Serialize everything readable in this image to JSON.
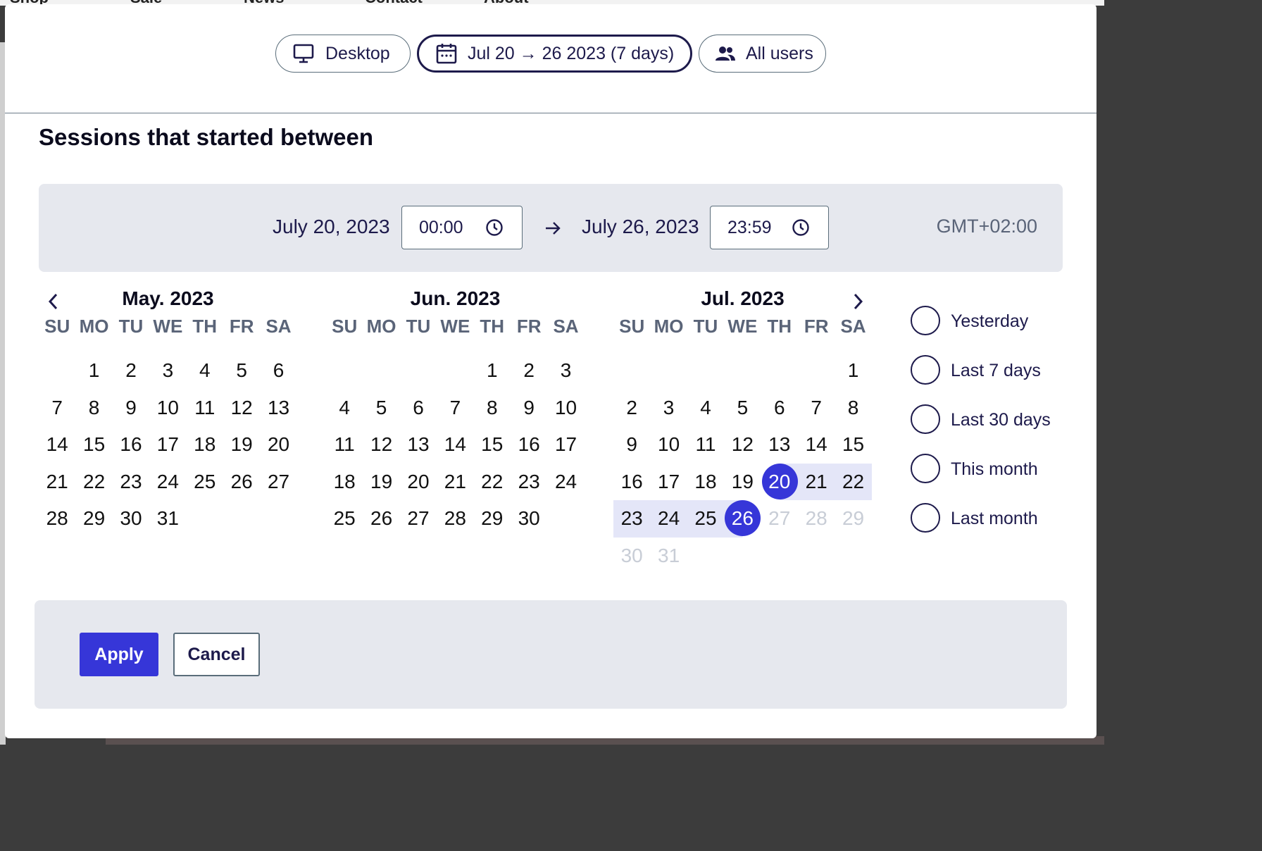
{
  "background_nav": [
    "Shop",
    "Sale",
    "News",
    "Contact",
    "About"
  ],
  "toolbar": {
    "device_label": "Desktop",
    "date_label": "Jul 20 → 26 2023 (7 days)",
    "users_label": "All users"
  },
  "section_title": "Sessions that started between",
  "range": {
    "start_date": "July 20, 2023",
    "start_time": "00:00",
    "end_date": "July 26, 2023",
    "end_time": "23:59",
    "timezone": "GMT+02:00"
  },
  "weekday_headers": [
    "SU",
    "MO",
    "TU",
    "WE",
    "TH",
    "FR",
    "SA"
  ],
  "calendars": [
    {
      "title": "May. 2023",
      "offset": 1,
      "days": 31,
      "trailing": []
    },
    {
      "title": "Jun. 2023",
      "offset": 4,
      "days": 30,
      "trailing": []
    },
    {
      "title": "Jul. 2023",
      "offset": 6,
      "days": 31,
      "selected_start": 20,
      "selected_end": 26,
      "disabled_after": 26
    }
  ],
  "presets": [
    "Yesterday",
    "Last 7 days",
    "Last 30 days",
    "This month",
    "Last month"
  ],
  "actions": {
    "apply_label": "Apply",
    "cancel_label": "Cancel"
  },
  "colors": {
    "accent": "#3636d8",
    "range_fill": "#e4e6f8",
    "text": "#1d1a4b",
    "muted": "#c8cdd6",
    "panel": "#e6e8ee"
  },
  "icons": {
    "device": "desktop-monitor-icon",
    "date": "calendar-icon",
    "users": "users-icon",
    "time": "clock-icon",
    "arrow": "arrow-right-icon",
    "prev": "chevron-left-icon",
    "next": "chevron-right-icon"
  }
}
